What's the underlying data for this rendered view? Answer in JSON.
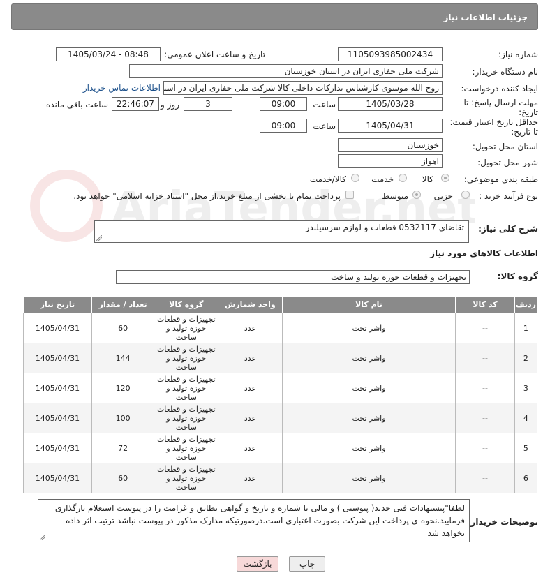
{
  "header": {
    "title": "جزئیات اطلاعات نیاز"
  },
  "form": {
    "need_number_label": "شماره نیاز:",
    "need_number": "1105093985002434",
    "announce_label": "تاریخ و ساعت اعلان عمومی:",
    "announce_value": "1405/03/24 - 08:48",
    "buyer_org_label": "نام دستگاه خریدار:",
    "buyer_org": "شرکت ملی حفاری ایران در استان خوزستان",
    "creator_label": "ایجاد کننده درخواست:",
    "creator": "روح الله موسوی کارشناس تدارکات داخلی کالا شرکت ملی حفاری ایران در استان",
    "buyer_contact_link": "اطلاعات تماس خریدار",
    "deadline_label_1": "مهلت ارسال پاسخ: تا",
    "deadline_label_2": "تاریخ:",
    "deadline_date": "1405/03/28",
    "time_label": "ساعت",
    "deadline_time": "09:00",
    "days_value": "3",
    "days_label": "روز و",
    "remaining_time": "22:46:07",
    "remaining_label": "ساعت باقی مانده",
    "validity_label_1": "حداقل تاریخ اعتبار قیمت:",
    "validity_label_2": "تا تاریخ:",
    "validity_date": "1405/04/31",
    "validity_time_label": "ساعت",
    "validity_time": "09:00",
    "province_label": "استان محل تحویل:",
    "province": "خوزستان",
    "city_label": "شهر محل تحویل:",
    "city": "اهواز",
    "category_label": "طبقه بندی موضوعی:",
    "category_options": [
      "کالا",
      "خدمت",
      "کالا/خدمت"
    ],
    "category_selected": "کالا",
    "process_label": "نوع فرآیند خرید :",
    "process_options": [
      "جزیی",
      "متوسط"
    ],
    "process_selected": "متوسط",
    "payment_checkbox_label": "پرداخت تمام یا بخشی از مبلغ خرید،از محل \"اسناد خزانه اسلامی\" خواهد بود."
  },
  "description": {
    "label": "شرح کلی نیاز:",
    "value": "تقاضای 0532117 قطعات و لوازم سرسیلندر"
  },
  "goods": {
    "section_title": "اطلاعات کالاهای مورد نیاز",
    "group_label": "گروه کالا:",
    "group_value": "تجهیزات و قطعات حوزه تولید و ساخت",
    "columns": [
      "ردیف",
      "کد کالا",
      "نام کالا",
      "واحد شمارش",
      "گروه کالا",
      "تعداد / مقدار",
      "تاریخ نیاز"
    ],
    "rows": [
      {
        "idx": "1",
        "code": "--",
        "name": "واشر تخت",
        "unit": "عدد",
        "group": "تجهیزات و قطعات حوزه تولید و ساخت",
        "qty": "60",
        "date": "1405/04/31"
      },
      {
        "idx": "2",
        "code": "--",
        "name": "واشر تخت",
        "unit": "عدد",
        "group": "تجهیزات و قطعات حوزه تولید و ساخت",
        "qty": "144",
        "date": "1405/04/31"
      },
      {
        "idx": "3",
        "code": "--",
        "name": "واشر تخت",
        "unit": "عدد",
        "group": "تجهیزات و قطعات حوزه تولید و ساخت",
        "qty": "120",
        "date": "1405/04/31"
      },
      {
        "idx": "4",
        "code": "--",
        "name": "واشر تخت",
        "unit": "عدد",
        "group": "تجهیزات و قطعات حوزه تولید و ساخت",
        "qty": "100",
        "date": "1405/04/31"
      },
      {
        "idx": "5",
        "code": "--",
        "name": "واشر تخت",
        "unit": "عدد",
        "group": "تجهیزات و قطعات حوزه تولید و ساخت",
        "qty": "72",
        "date": "1405/04/31"
      },
      {
        "idx": "6",
        "code": "--",
        "name": "واشر تخت",
        "unit": "عدد",
        "group": "تجهیزات و قطعات حوزه تولید و ساخت",
        "qty": "60",
        "date": "1405/04/31"
      }
    ]
  },
  "buyer_notes": {
    "label": "توضیحات خریدار:",
    "value": "لطفا\"پیشنهادات فنی جدید( پیوستی ) و مالی با شماره و تاریخ و گواهی تطابق و غرامت را در پیوست استعلام بارگذاری فرمایید.نحوه ی پرداخت این شرکت بصورت اعتباری است.درصورتیکه مدارک مذکور در پیوست نباشد ترتیب اثر داده نخواهد شد"
  },
  "buttons": {
    "print": "چاپ",
    "back": "بازگشت"
  },
  "watermark": {
    "text": "AriaTender.net"
  },
  "colors": {
    "header_bg": "#8a8a8a",
    "link": "#1a4f8a",
    "back_button_bg": "#f7d9d9",
    "print_button_bg": "#eeeeee"
  }
}
